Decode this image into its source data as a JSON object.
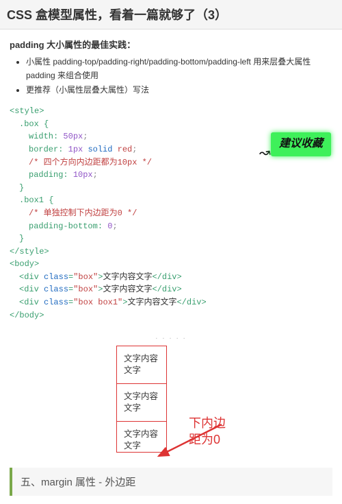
{
  "header": {
    "title": "CSS 盒模型属性，看着一篇就够了（3）"
  },
  "intro": {
    "subhead": "padding 大小属性的最佳实践：",
    "bullets": [
      "小属性 padding-top/padding-right/padding-bottom/padding-left 用来层叠大属性 padding 来组合使用",
      "更推荐（小属性层叠大属性）写法"
    ]
  },
  "badge": {
    "text": "建议收藏"
  },
  "code": {
    "l01": "<style>",
    "l02": ".box {",
    "l03a": "width",
    "l03b": ": ",
    "l03c": "50px",
    "l03d": ";",
    "l04a": "border",
    "l04b": ": ",
    "l04c": "1px",
    "l04d": " ",
    "l04e": "solid",
    "l04f": " ",
    "l04g": "red",
    "l04h": ";",
    "l05": "/* 四个方向内边距都为10px */",
    "l06a": "padding",
    "l06b": ": ",
    "l06c": "10px",
    "l06d": ";",
    "l07": "}",
    "l08": ".box1 {",
    "l09": "/* 单独控制下内边距为0 */",
    "l10a": "padding-bottom",
    "l10b": ": ",
    "l10c": "0",
    "l10d": ";",
    "l11": "}",
    "l12": "</style>",
    "l13": "<body>",
    "l14a": "<div ",
    "l14b": "class",
    "l14c": "=",
    "l14d": "\"box\"",
    "l14e": ">",
    "l14f": "文字内容文字",
    "l14g": "</div>",
    "l15d": "\"box\"",
    "l16d": "\"box box1\"",
    "l17": "</body>"
  },
  "separator": ". . . . .",
  "demo": {
    "boxText": "文字内容文字",
    "caption1": "下内边",
    "caption2": "距为0"
  },
  "nextSection": {
    "title": "五、margin 属性 - 外边距"
  }
}
